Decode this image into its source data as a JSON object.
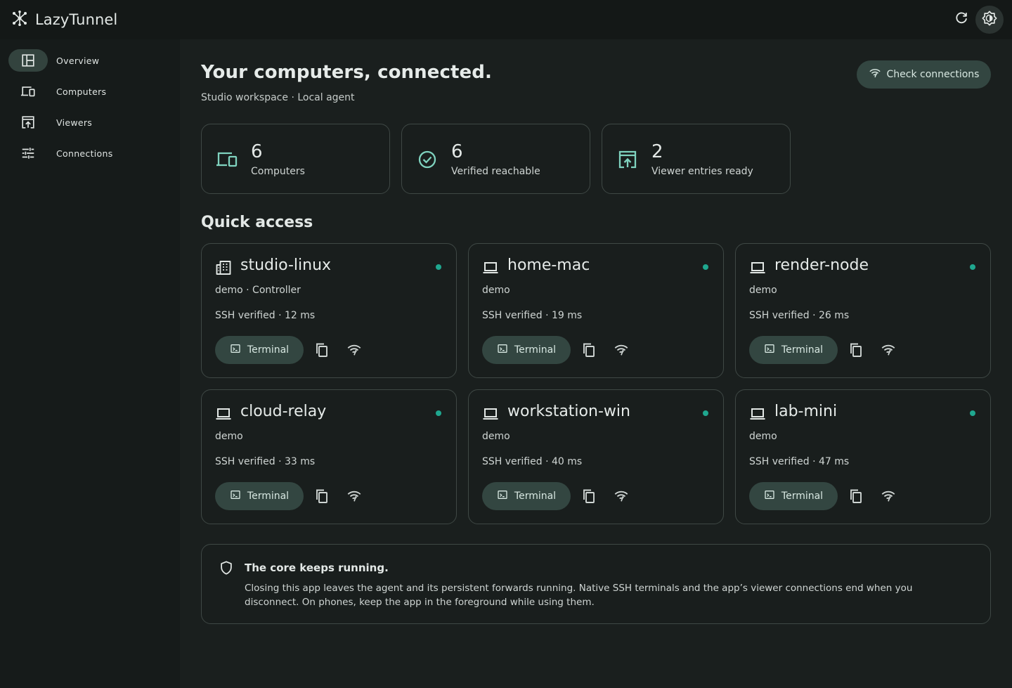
{
  "app": {
    "name": "LazyTunnel"
  },
  "colors": {
    "accent": "#1fa78f",
    "tonal_button": "#334641",
    "icon": "#7fd3bf"
  },
  "sidebar": {
    "items": [
      {
        "label": "Overview",
        "icon": "dashboard-icon",
        "active": true
      },
      {
        "label": "Computers",
        "icon": "devices-icon"
      },
      {
        "label": "Viewers",
        "icon": "open-in-browser-icon"
      },
      {
        "label": "Connections",
        "icon": "tune-icon"
      }
    ]
  },
  "header": {
    "title": "Your computers, connected.",
    "subtitle": "Studio workspace · Local agent",
    "check_button": "Check connections"
  },
  "stats": [
    {
      "value": "6",
      "label": "Computers",
      "icon": "devices-icon"
    },
    {
      "value": "6",
      "label": "Verified reachable",
      "icon": "check-circle-icon"
    },
    {
      "value": "2",
      "label": "Viewer entries ready",
      "icon": "open-in-browser-icon"
    }
  ],
  "quick_access": {
    "title": "Quick access",
    "terminal_label": "Terminal",
    "computers": [
      {
        "name": "studio-linux",
        "sub": "demo · Controller",
        "status": "SSH verified · 12 ms",
        "icon": "domain-icon"
      },
      {
        "name": "home-mac",
        "sub": "demo",
        "status": "SSH verified · 19 ms",
        "icon": "laptop-icon"
      },
      {
        "name": "render-node",
        "sub": "demo",
        "status": "SSH verified · 26 ms",
        "icon": "laptop-icon"
      },
      {
        "name": "cloud-relay",
        "sub": "demo",
        "status": "SSH verified · 33 ms",
        "icon": "laptop-icon"
      },
      {
        "name": "workstation-win",
        "sub": "demo",
        "status": "SSH verified · 40 ms",
        "icon": "laptop-icon"
      },
      {
        "name": "lab-mini",
        "sub": "demo",
        "status": "SSH verified · 47 ms",
        "icon": "laptop-icon"
      }
    ]
  },
  "notice": {
    "title": "The core keeps running.",
    "body": "Closing this app leaves the agent and its persistent forwards running. Native SSH terminals and the app’s viewer connections end when you disconnect. On phones, keep the app in the foreground while using them."
  }
}
